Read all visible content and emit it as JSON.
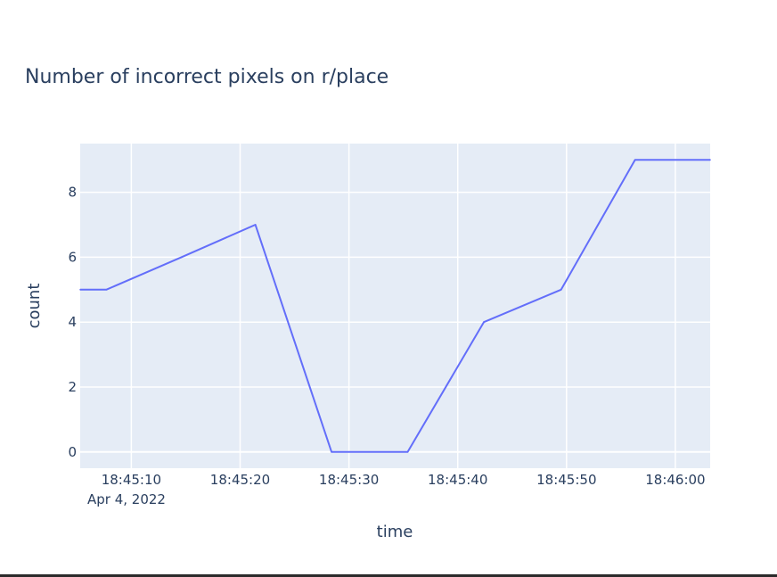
{
  "chart_data": {
    "type": "line",
    "title": "Number of incorrect pixels on r/place",
    "xlabel": "time",
    "ylabel": "count",
    "x_date_label": "Apr 4, 2022",
    "xlim": [
      "18:45:05.3",
      "18:46:03.2"
    ],
    "ylim": [
      -0.5,
      9.5
    ],
    "grid": true,
    "x_ticks": [
      "18:45:10",
      "18:45:20",
      "18:45:30",
      "18:45:40",
      "18:45:50",
      "18:46:00"
    ],
    "y_ticks": [
      0,
      2,
      4,
      6,
      8
    ],
    "series": [
      {
        "color": "#636efa",
        "x": [
          "18:45:05.3",
          "18:45:07.7",
          "18:45:14.6",
          "18:45:21.4",
          "18:45:28.4",
          "18:45:35.4",
          "18:45:42.4",
          "18:45:49.5",
          "18:45:56.3",
          "18:46:03.2"
        ],
        "y": [
          5,
          5,
          6,
          7,
          0,
          0,
          4,
          5,
          9,
          9
        ]
      }
    ]
  },
  "colors": {
    "plot_background": "#e5ecf6",
    "grid": "#ffffff",
    "line": "#636efa",
    "text": "#2a3f5f"
  }
}
